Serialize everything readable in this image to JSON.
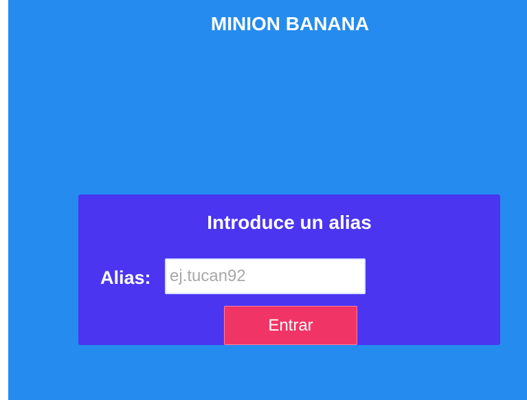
{
  "app": {
    "title": "MINION BANANA"
  },
  "login": {
    "heading": "Introduce un alias",
    "alias_label": "Alias:",
    "alias_value": "",
    "alias_placeholder": "ej.tucan92",
    "submit_label": "Entrar"
  },
  "colors": {
    "background": "#258bef",
    "card": "#4b35f1",
    "button": "#f13466",
    "text": "#ffffff"
  }
}
